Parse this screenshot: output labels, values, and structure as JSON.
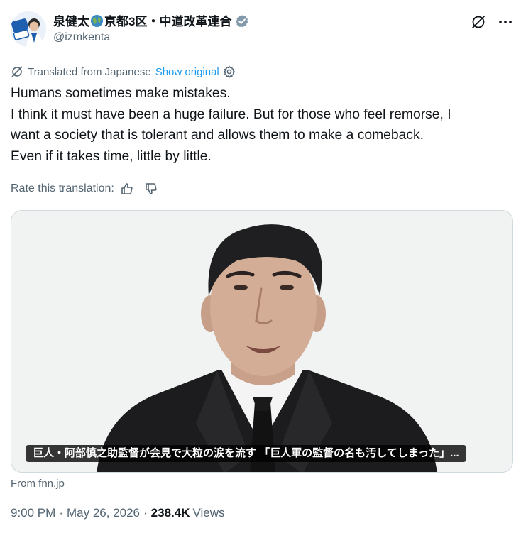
{
  "author": {
    "display_name_part1": "泉健太",
    "display_name_part2": "京都3区・中道改革連合",
    "handle": "@izmkenta",
    "verified": true
  },
  "header_icons": [
    "grok-icon",
    "more-icon"
  ],
  "translation": {
    "label": "Translated from Japanese",
    "show_original": "Show original"
  },
  "tweet_text": [
    "Humans sometimes make mistakes.",
    "I think it must have been a huge failure. But for those who feel remorse, I",
    "want a society that is tolerant and allows them to make a comeback.",
    "Even if it takes time, little by little."
  ],
  "rate_translation": "Rate this translation:",
  "media": {
    "caption": "巨人・阿部慎之助監督が会見で大粒の涙を流す 「巨人軍の監督の名も汚してしまった」..."
  },
  "source": "From fnn.jp",
  "timestamp": {
    "time": "9:00 PM",
    "date": "May 26, 2026",
    "views_count": "238.4K",
    "views_label": "Views"
  },
  "colors": {
    "link": "#1d9bf0",
    "secondary_text": "#536471",
    "primary_text": "#0f1419",
    "border": "#cfd9de"
  }
}
